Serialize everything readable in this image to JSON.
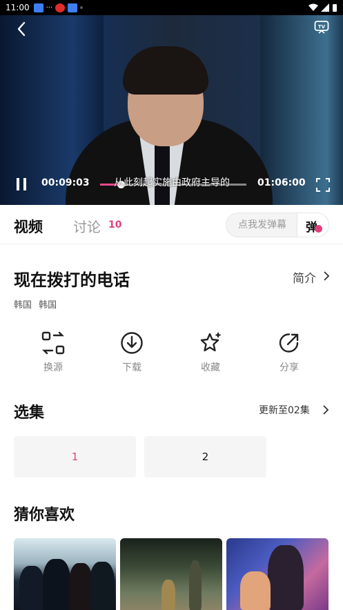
{
  "status_bar": {
    "time": "11:00"
  },
  "player": {
    "current_time": "00:09:03",
    "total_time": "01:06:00",
    "progress": 0.14,
    "subtitle": "从此刻起实施由政府主导的"
  },
  "tabs": {
    "video_label": "视频",
    "discuss_label": "讨论",
    "discuss_count": "10",
    "danmu_placeholder": "点我发弹幕",
    "danmu_button": "弹"
  },
  "show": {
    "title": "现在拨打的电话",
    "intro_label": "简介",
    "tags": [
      "韩国",
      "韩国"
    ]
  },
  "actions": [
    {
      "label": "换源",
      "icon": "switch-source-icon"
    },
    {
      "label": "下载",
      "icon": "download-icon"
    },
    {
      "label": "收藏",
      "icon": "star-icon"
    },
    {
      "label": "分享",
      "icon": "share-icon"
    }
  ],
  "episodes": {
    "section_title": "选集",
    "update_text": "更新至02集",
    "items": [
      {
        "label": "1",
        "active": true
      },
      {
        "label": "2",
        "active": false
      }
    ]
  },
  "recommend": {
    "section_title": "猜你喜欢"
  },
  "colors": {
    "accent": "#e2407d",
    "progress": "#f04a8c"
  }
}
